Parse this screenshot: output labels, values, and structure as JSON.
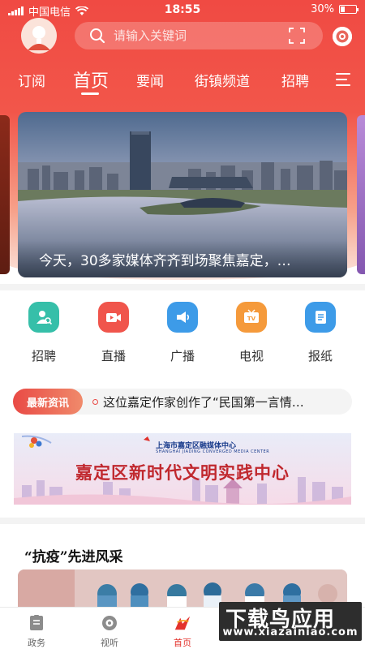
{
  "status_bar": {
    "carrier": "中国电信",
    "time": "18:55",
    "battery": "30%",
    "battery_level": 0.3
  },
  "search": {
    "placeholder": "请输入关键词"
  },
  "tabs": [
    {
      "label": "订阅"
    },
    {
      "label": "首页",
      "active": true
    },
    {
      "label": "要闻"
    },
    {
      "label": "街镇频道"
    },
    {
      "label": "招聘"
    }
  ],
  "banner": {
    "caption": "今天，30多家媒体齐齐到场聚焦嘉定，…"
  },
  "quick_entries": [
    {
      "label": "招聘",
      "icon": "recruit-icon",
      "color": "#36bfa9"
    },
    {
      "label": "直播",
      "icon": "live-icon",
      "color": "#f0554c"
    },
    {
      "label": "广播",
      "icon": "broadcast-icon",
      "color": "#3d9be8"
    },
    {
      "label": "电视",
      "icon": "tv-icon",
      "color": "#f59a3b"
    },
    {
      "label": "报纸",
      "icon": "newspaper-icon",
      "color": "#3d9be8"
    }
  ],
  "news_ticker": {
    "badge": "最新资讯",
    "text": "这位嘉定作家创作了“民国第一言情…"
  },
  "ad_banner": {
    "org": "上海市嘉定区融媒体中心",
    "org_en": "SHANGHAI JIADING CONVERGED MEDIA CENTER",
    "title": "嘉定区新时代文明实践中心"
  },
  "section": {
    "title": "“抗疫”先进风采"
  },
  "bottom_nav": [
    {
      "label": "政务",
      "icon": "government-icon"
    },
    {
      "label": "视听",
      "icon": "video-audio-icon"
    },
    {
      "label": "首页",
      "icon": "home-icon",
      "active": true
    }
  ],
  "watermark": {
    "main": "下载鸟应用",
    "sub": "www.xiazainiao.com"
  },
  "colors": {
    "accent": "#e3322c",
    "header_top": "#f04a43"
  }
}
